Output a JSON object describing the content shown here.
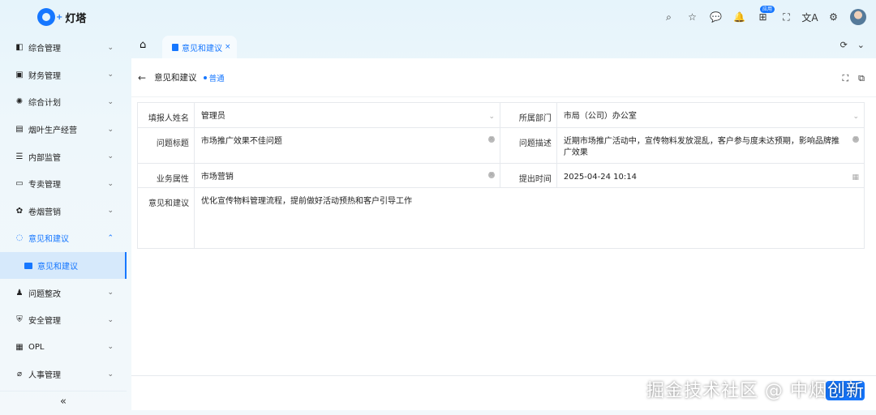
{
  "app": {
    "name": "灯塔",
    "logo_plus": "+"
  },
  "topbar": {
    "icons": [
      {
        "name": "search-icon",
        "glyph": "⌕"
      },
      {
        "name": "star-icon",
        "glyph": "☆"
      },
      {
        "name": "message-icon",
        "glyph": "💬"
      },
      {
        "name": "bell-icon",
        "glyph": "🔔"
      },
      {
        "name": "apps-icon",
        "glyph": "⊞",
        "badge": "应用"
      },
      {
        "name": "fullscreen-icon",
        "glyph": "⛶"
      },
      {
        "name": "translate-icon",
        "glyph": "文A"
      },
      {
        "name": "settings-icon",
        "glyph": "⚙"
      }
    ]
  },
  "sidebar": {
    "items": [
      {
        "label": "综合管理",
        "icon": "◧"
      },
      {
        "label": "财务管理",
        "icon": "▣"
      },
      {
        "label": "综合计划",
        "icon": "✺"
      },
      {
        "label": "烟叶生产经营",
        "icon": "▤"
      },
      {
        "label": "内部监管",
        "icon": "☰"
      },
      {
        "label": "专卖管理",
        "icon": "▭"
      },
      {
        "label": "卷烟营销",
        "icon": "✿"
      },
      {
        "label": "意见和建议",
        "icon": "◌"
      },
      {
        "label": "问题整改",
        "icon": "♟"
      },
      {
        "label": "安全管理",
        "icon": "⛨"
      },
      {
        "label": "OPL",
        "icon": "▦"
      },
      {
        "label": "人事管理",
        "icon": "⌀"
      }
    ],
    "sub_item": "意见和建议",
    "collapse": "«"
  },
  "tabs": {
    "home": "⌂",
    "active": "意见和建议",
    "close": "×"
  },
  "page": {
    "back": "←",
    "title": "意见和建议",
    "status": "普通"
  },
  "form": {
    "reporter": {
      "label": "填报人姓名",
      "value": "管理员"
    },
    "department": {
      "label": "所属部门",
      "value": "市局（公司）办公室"
    },
    "issue_title": {
      "label": "问题标题",
      "value": "市场推广效果不佳问题"
    },
    "issue_desc": {
      "label": "问题描述",
      "value": "近期市场推广活动中，宣传物料发放混乱，客户参与度未达预期，影响品牌推广效果"
    },
    "business": {
      "label": "业务属性",
      "value": "市场营销"
    },
    "submit_time": {
      "label": "提出时间",
      "value": "2025-04-24 10:14"
    },
    "suggestion": {
      "label": "意见和建议",
      "value": "优化宣传物料管理流程，提前做好活动预热和客户引导工作"
    }
  },
  "watermark": "掘金技术社区 @ 中烟创新",
  "colors": {
    "accent": "#1677ff",
    "active_bg": "#d6e9fb"
  }
}
